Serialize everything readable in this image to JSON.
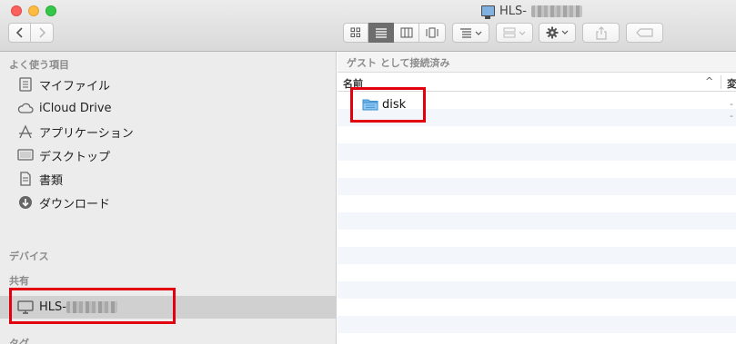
{
  "window": {
    "title": "HLS-",
    "title_icon": "monitor-icon"
  },
  "toolbar": {
    "back_icon": "chevron-left-icon",
    "forward_icon": "chevron-right-icon",
    "view_modes": [
      "icon-view",
      "list-view",
      "column-view",
      "coverflow-view"
    ],
    "active_view": "list-view",
    "arrange_icon": "arrange-icon",
    "group_icon": "group-icon",
    "action_icon": "gear-icon",
    "share_icon": "share-icon",
    "tag_icon": "tag-icon"
  },
  "sidebar": {
    "favorites_heading": "よく使う項目",
    "favorites": [
      {
        "label": "マイファイル",
        "icon": "all-my-files-icon"
      },
      {
        "label": "iCloud Drive",
        "icon": "cloud-icon"
      },
      {
        "label": "アプリケーション",
        "icon": "applications-icon"
      },
      {
        "label": "デスクトップ",
        "icon": "desktop-icon"
      },
      {
        "label": "書類",
        "icon": "documents-icon"
      },
      {
        "label": "ダウンロード",
        "icon": "downloads-icon"
      }
    ],
    "devices_heading": "デバイス",
    "shared_heading": "共有",
    "shared": [
      {
        "label": "HLS-",
        "icon": "display-icon",
        "selected": true
      }
    ],
    "tags_heading": "タグ"
  },
  "content": {
    "path_label": "ゲスト として接続済み",
    "column_name": "名前",
    "column_cut": "変",
    "sort_indicator": "^",
    "files": [
      {
        "name": "disk",
        "icon": "shared-folder-icon",
        "detail": "--"
      }
    ]
  },
  "colors": {
    "annotation": "#e3000f",
    "sidebar_bg": "#ececec",
    "selected_bg": "#d0d0d0"
  }
}
